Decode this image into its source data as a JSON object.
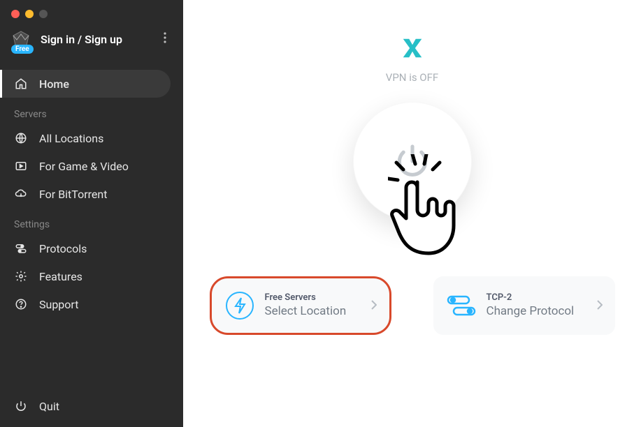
{
  "sidebar": {
    "free_badge": "Free",
    "account_label": "Sign in / Sign up",
    "home_label": "Home",
    "servers_section": "Servers",
    "all_locations_label": "All Locations",
    "game_video_label": "For Game & Video",
    "bittorrent_label": "For BitTorrent",
    "settings_section": "Settings",
    "protocols_label": "Protocols",
    "features_label": "Features",
    "support_label": "Support",
    "quit_label": "Quit"
  },
  "main": {
    "vpn_status": "VPN is OFF",
    "location_card": {
      "label": "Free Servers",
      "action": "Select Location"
    },
    "protocol_card": {
      "label": "TCP-2",
      "action": "Change Protocol"
    }
  }
}
